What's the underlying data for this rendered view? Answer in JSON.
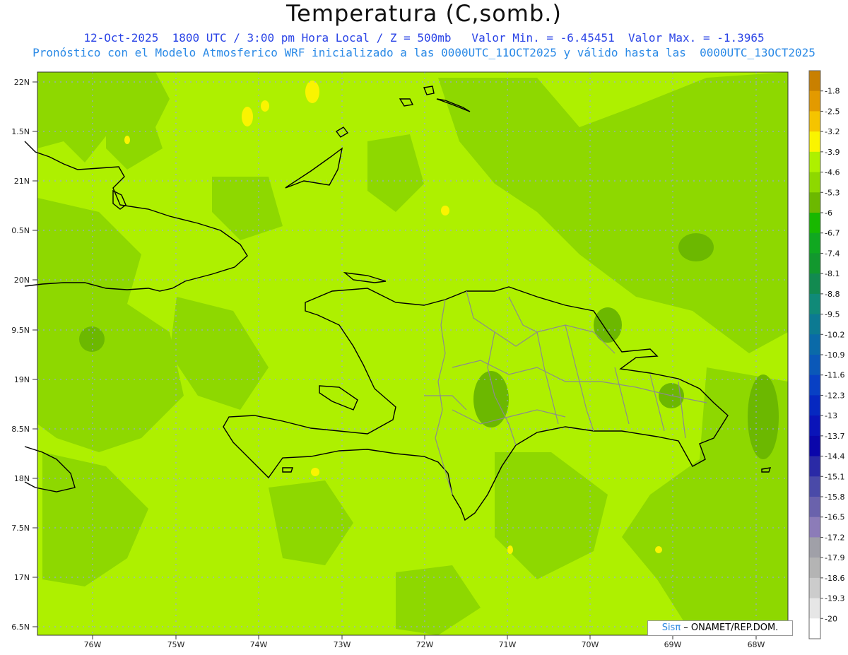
{
  "header": {
    "title": "Temperatura (C,somb.)",
    "line1": "12-Oct-2025  1800 UTC / 3:00 pm Hora Local / Z = 500mb   Valor Min. = -6.45451  Valor Max. = -1.3965",
    "line2": "Pronóstico con el Modelo Atmosferico WRF inicializado a las 0000UTC_11OCT2025 y válido hasta las  0000UTC_13OCT2025"
  },
  "axes": {
    "lat_labels": [
      "22N",
      "1.5N",
      "21N",
      "0.5N",
      "20N",
      "9.5N",
      "19N",
      "8.5N",
      "18N",
      "7.5N",
      "17N",
      "6.5N"
    ],
    "lon_labels": [
      "76W",
      "75W",
      "74W",
      "73W",
      "72W",
      "71W",
      "70W",
      "69W",
      "68W"
    ]
  },
  "colorbar": {
    "labels": [
      "-1.8",
      "-2.5",
      "-3.2",
      "-3.9",
      "-4.6",
      "-5.3",
      "-6",
      "-6.7",
      "-7.4",
      "-8.1",
      "-8.8",
      "-9.5",
      "-10.2",
      "-10.9",
      "-11.6",
      "-12.3",
      "-13",
      "-13.7",
      "-14.4",
      "-15.1",
      "-15.8",
      "-16.5",
      "-17.2",
      "-17.9",
      "-18.6",
      "-19.3",
      "-20"
    ],
    "colors": [
      "#c98000",
      "#e39a00",
      "#f5c400",
      "#faf400",
      "#aef000",
      "#8ed800",
      "#6cb800",
      "#18b800",
      "#10a820",
      "#12982e",
      "#128a50",
      "#108a78",
      "#0c7a92",
      "#0a6aa8",
      "#0a58b8",
      "#0840c4",
      "#0628c0",
      "#0a14b8",
      "#0a06aa",
      "#2a2aa6",
      "#4a4aa8",
      "#6a62ac",
      "#8c7cb8",
      "#a0a0a8",
      "#b4b4b4",
      "#cccccc",
      "#e6e6e6",
      "#ffffff"
    ]
  },
  "credit": {
    "sis": "Sisπ",
    "org": " – ONAMET/REP.DOM."
  }
}
